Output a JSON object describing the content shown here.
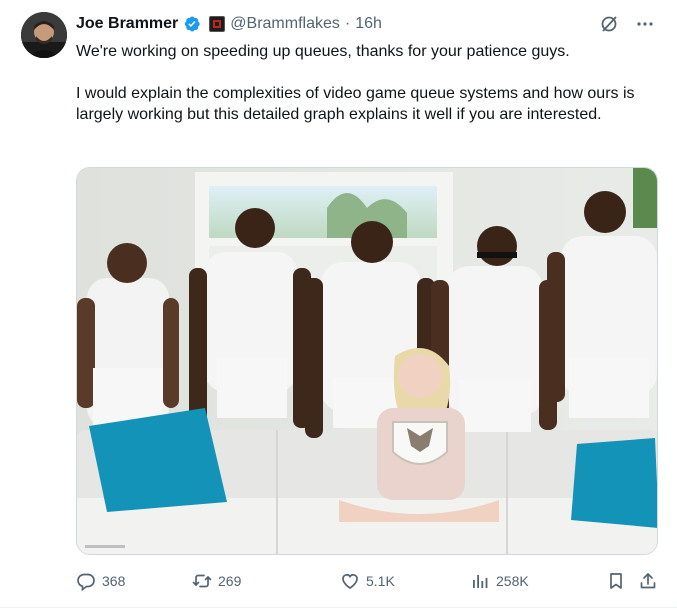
{
  "author": {
    "display_name": "Joe Brammer",
    "handle": "@Brammflakes",
    "separator": "·",
    "time": "16h"
  },
  "text": {
    "paragraph1": "We're working on speeding up queues, thanks for your patience guys.",
    "paragraph2": "I would explain the complexities of video game queue systems and how ours is largely working but this detailed graph explains it well if you are interested."
  },
  "actions": {
    "replies": "368",
    "reposts": "269",
    "likes": "5.1K",
    "views": "258K"
  },
  "icons": {
    "verified": "verified-badge-icon",
    "affiliate": "affiliate-badge-icon",
    "grok": "grok-icon",
    "more": "more-icon",
    "reply": "reply-icon",
    "repost": "repost-icon",
    "like": "heart-icon",
    "views": "views-icon",
    "bookmark": "bookmark-icon",
    "share": "share-icon"
  },
  "colors": {
    "text": "#0f1419",
    "secondary": "#536471",
    "verified": "#1d9bf0",
    "teal_pillow": "#1493b8",
    "sofa": "#ececec"
  }
}
